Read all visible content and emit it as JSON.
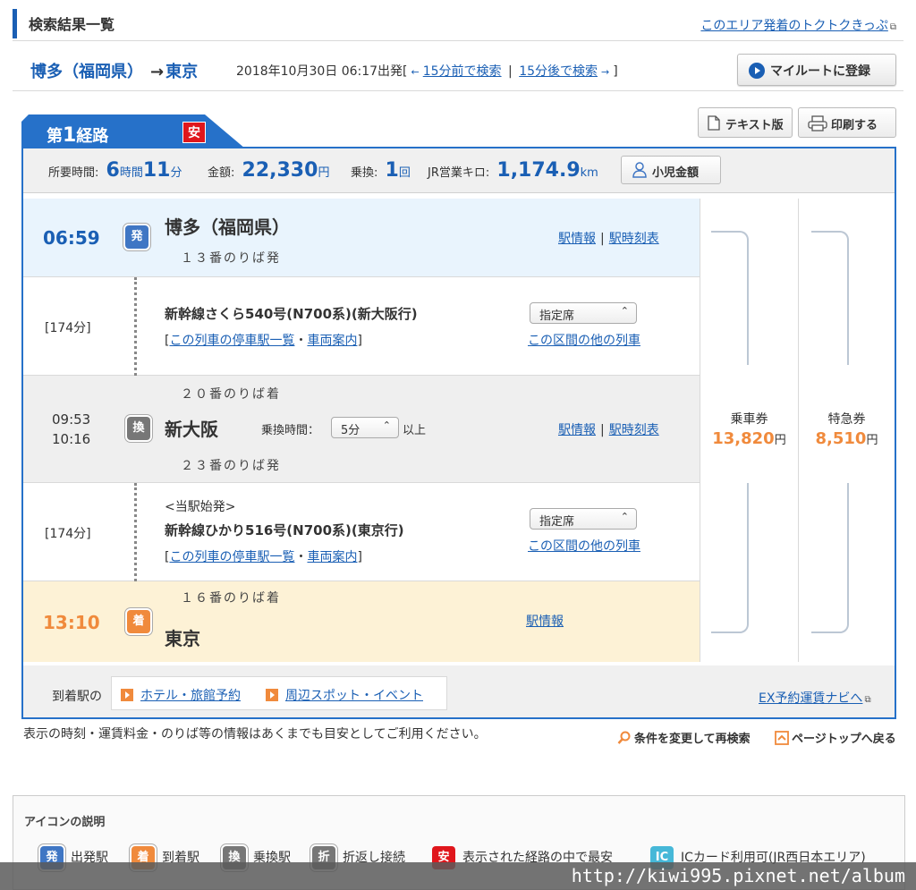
{
  "header": {
    "title": "検索結果一覧",
    "area_link": "このエリア発着のトクトクきっぷ"
  },
  "route": {
    "from": "博多（福岡県）",
    "arrow": "→",
    "to": "東京",
    "datetime": "2018年10月30日 06:17出発[",
    "prev_arrow": "←",
    "prev_link": "15分前で検索",
    "next_link": "15分後で検索",
    "next_arrow": "→",
    "close": "]",
    "my_route_button": "マイルートに登録"
  },
  "tab": {
    "label_prefix": "第",
    "label_num": "1",
    "label_suffix": "経路",
    "badge": "安"
  },
  "actions": {
    "text_version": "テキスト版",
    "print": "印刷する"
  },
  "summary": {
    "time_label": "所要時間:",
    "hours": "6",
    "hours_unit": "時間",
    "minutes": "11",
    "minutes_unit": "分",
    "fare_label": "金額:",
    "fare": "22,330",
    "fare_unit": "円",
    "transfer_label": "乗換:",
    "transfers": "1",
    "transfer_unit": "回",
    "km_label": "JR営業キロ:",
    "km": "1,174.9",
    "km_unit": "km",
    "kids_button": "小児金額"
  },
  "departure": {
    "time": "06:59",
    "badge": "発",
    "station": "博多（福岡県）",
    "platform": "１３番のりば発",
    "info_link": "駅情報",
    "timetable_link": "駅時刻表",
    "sep": "|"
  },
  "segment1": {
    "duration": "[174分]",
    "train": "新幹線さくら540号(N700系)(新大阪行)",
    "link_open": "[",
    "stops_link": "この列車の停車駅一覧",
    "dot": "・",
    "car_link": "車両案内",
    "link_close": "]",
    "seat": "指定席",
    "other_trains": "この区間の他の列車"
  },
  "transfer": {
    "arr_time": "09:53",
    "dep_time": "10:16",
    "badge": "換",
    "station": "新大阪",
    "xfer_label": "乗換時間：",
    "xfer_value": "5分",
    "xfer_suffix": "以上",
    "arr_platform": "２０番のりば着",
    "dep_platform": "２３番のりば発",
    "info_link": "駅情報",
    "timetable_link": "駅時刻表",
    "sep": "|"
  },
  "segment2": {
    "duration": "[174分]",
    "origin_note": "<当駅始発>",
    "train": "新幹線ひかり516号(N700系)(東京行)",
    "link_open": "[",
    "stops_link": "この列車の停車駅一覧",
    "dot": "・",
    "car_link": "車両案内",
    "link_close": "]",
    "seat": "指定席",
    "other_trains": "この区間の他の列車"
  },
  "arrival": {
    "time": "13:10",
    "badge": "着",
    "station": "東京",
    "platform": "１６番のりば着",
    "info_link": "駅情報"
  },
  "fares": {
    "ticket_label": "乗車券",
    "ticket_value": "13,820",
    "express_label": "特急券",
    "express_value": "8,510",
    "unit": "円"
  },
  "footer": {
    "label": "到着駅の",
    "hotel_link": "ホテル・旅館予約",
    "spot_link": "周辺スポット・イベント",
    "ex_link": "EX予約運賃ナビへ"
  },
  "note": "表示の時刻・運賃料金・のりば等の情報はあくまでも目安としてご利用ください。",
  "research": "条件を変更して再検索",
  "page_top": "ページトップへ戻る",
  "legend": {
    "title": "アイコンの説明",
    "items": [
      {
        "badge": "発",
        "label": "出発駅"
      },
      {
        "badge": "着",
        "label": "到着駅"
      },
      {
        "badge": "換",
        "label": "乗換駅"
      },
      {
        "badge": "折",
        "label": "折返し接続"
      },
      {
        "badge": "安",
        "label": "表示された経路の中で最安"
      },
      {
        "badge": "IC",
        "label": "ICカード利用可(JR西日本エリア)"
      }
    ]
  },
  "watermark": "http://kiwi995.pixnet.net/album"
}
